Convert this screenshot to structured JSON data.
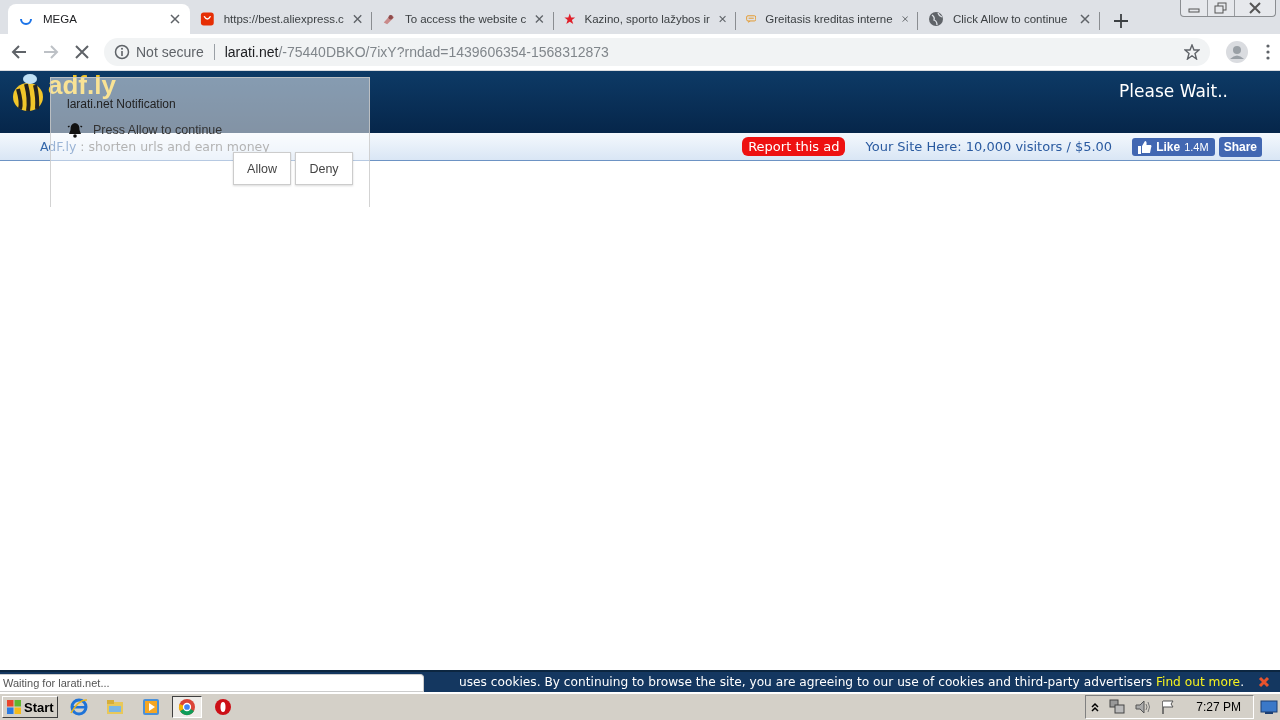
{
  "tabs": [
    {
      "title": "MEGA",
      "kind": "loading",
      "selected": true
    },
    {
      "title": "https://best.aliexpress.c",
      "kind": "shop",
      "selected": false
    },
    {
      "title": "To access the website c",
      "kind": "ribbon",
      "selected": false
    },
    {
      "title": "Kazino, sporto lažybos ir",
      "kind": "star",
      "selected": false
    },
    {
      "title": "Greitasis kreditas interne",
      "kind": "chat",
      "selected": false
    },
    {
      "title": "Click Allow to continue",
      "kind": "web",
      "selected": false
    }
  ],
  "toolbar": {
    "security": "Not secure",
    "url_host": "larati.net",
    "url_path": "/-75440DBKO/7ixY?rndad=1439606354-1568312873"
  },
  "site": {
    "logo": "adf.ly",
    "status": "Please Wait..",
    "tagline_brand": "AdF.ly",
    "tagline": " : shorten urls and earn money",
    "report_button": "Report this ad",
    "promo": "Your Site Here: 10,000 visitors / $5.00",
    "like_button": "Like",
    "like_count": "1.4M",
    "share_button": "Share"
  },
  "notification": {
    "title": "larati.net Notification",
    "message": "Press Allow to continue",
    "buttons": [
      "Allow",
      "Deny"
    ]
  },
  "cookie_bar": {
    "text": "uses cookies. By continuing to browse the site, you are agreeing to our use of cookies and third-party advertisers",
    "link": "Find out more",
    "end": "."
  },
  "status_bubble": "Waiting for larati.net...",
  "taskbar": {
    "start": "Start",
    "apps": [
      {
        "kind": "ie",
        "selected": false
      },
      {
        "kind": "folder",
        "selected": false
      },
      {
        "kind": "media",
        "selected": false
      },
      {
        "kind": "chrome",
        "selected": true
      },
      {
        "kind": "opera",
        "selected": false
      }
    ],
    "clock": "7:27 PM"
  }
}
